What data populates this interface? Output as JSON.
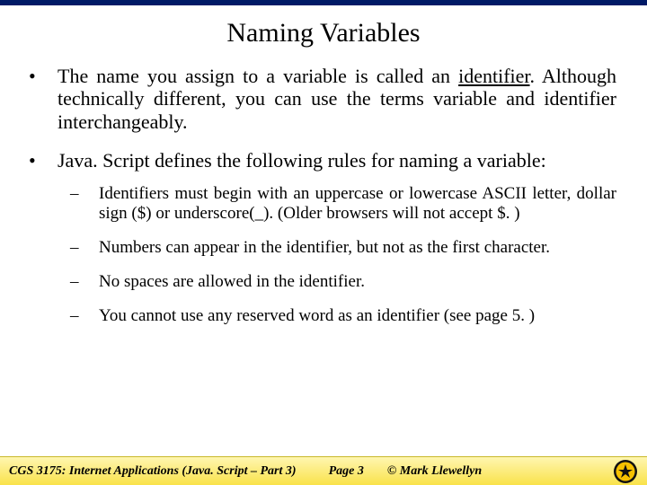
{
  "title": "Naming Variables",
  "bullets": [
    {
      "text_pre": "The name you assign to a variable is called an ",
      "underlined": "identifier",
      "text_post": ". Although technically different, you can use the terms variable and identifier interchangeably."
    },
    {
      "text": "Java. Script defines the following rules for naming a variable:",
      "sub": [
        "Identifiers must begin with an uppercase or lowercase ASCII letter, dollar sign ($) or underscore(_).  (Older browsers will not accept $. )",
        "Numbers can appear in the identifier, but not as the first character.",
        "No spaces are allowed in the identifier.",
        "You cannot use any reserved word as an identifier (see page 5. )"
      ]
    }
  ],
  "footer": {
    "course": "CGS 3175: Internet Applications (Java. Script – Part 3)",
    "page": "Page 3",
    "copyright": "© Mark Llewellyn"
  }
}
